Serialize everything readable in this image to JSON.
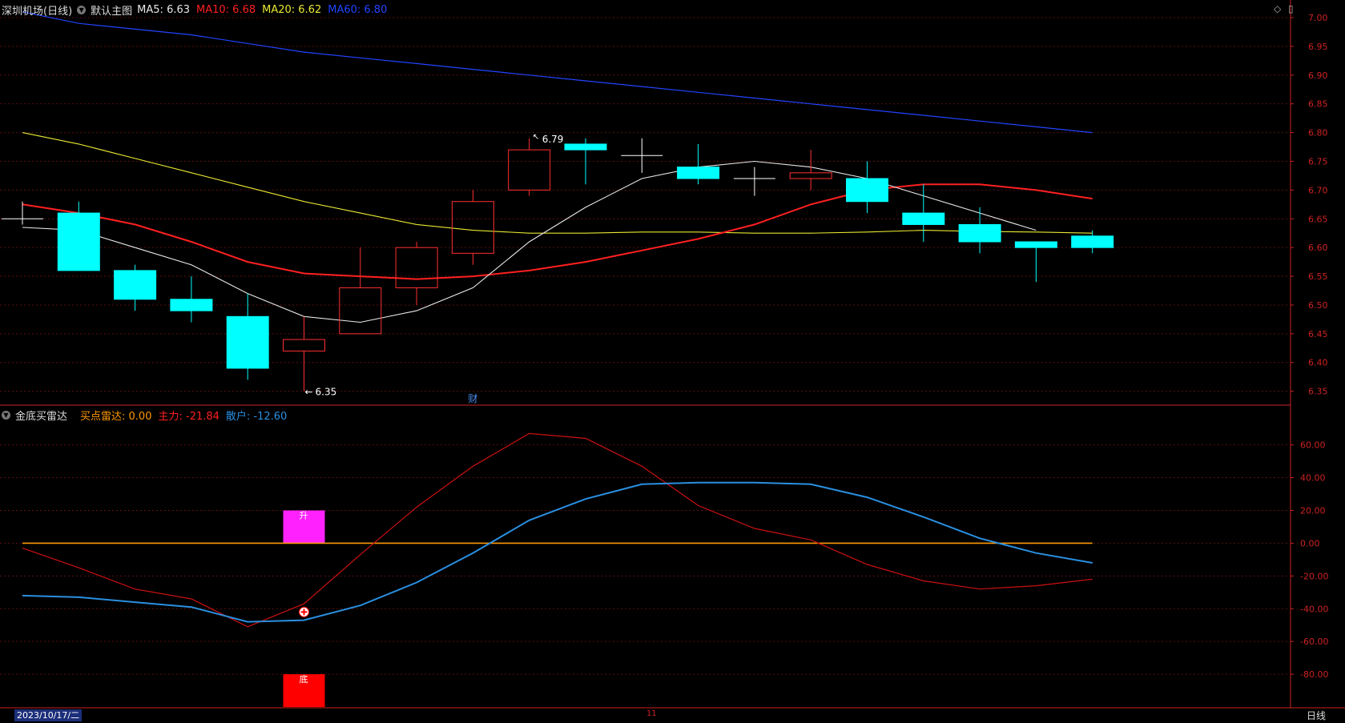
{
  "header": {
    "stock_name": "深圳机场(日线)",
    "template_name": "默认主图",
    "ma_items": [
      {
        "label": "MA5: 6.63",
        "color": "#e8e8e8"
      },
      {
        "label": "MA10: 6.68",
        "color": "#ff2020"
      },
      {
        "label": "MA20: 6.62",
        "color": "#e8e832"
      },
      {
        "label": "MA60: 6.80",
        "color": "#2244ff"
      }
    ]
  },
  "sub_header": {
    "indicator_name": "金底买雷达",
    "items": [
      {
        "label": "买点雷达: 0.00",
        "color": "#ff9900"
      },
      {
        "label": "主力: -21.84",
        "color": "#ff2020"
      },
      {
        "label": "散户: -12.60",
        "color": "#2a8fe0"
      }
    ]
  },
  "top_icons": {
    "diamond": "◇",
    "square": "▯"
  },
  "bottom_bar": {
    "date": "2023/10/17/二",
    "month_mark": "11",
    "period": "日线"
  },
  "colors": {
    "up": "#ff3030",
    "down": "#00ffff",
    "ma5": "#e8e8e8",
    "ma10": "#ff2020",
    "ma20": "#e8e832",
    "ma60": "#2244ff",
    "zero_line": "#ff9900",
    "main_force": "#cc1111",
    "retail": "#2a8fe0",
    "grid": "#5a1010",
    "axis": "#cc2222"
  },
  "chart_data": [
    {
      "type": "candlestick",
      "ylim": [
        6.33,
        7.0
      ],
      "y_ticks": [
        "7.00",
        "6.95",
        "6.90",
        "6.85",
        "6.80",
        "6.75",
        "6.70",
        "6.65",
        "6.60",
        "6.55",
        "6.50",
        "6.45",
        "6.40",
        "6.35"
      ],
      "candles": [
        {
          "o": 6.65,
          "h": 6.68,
          "l": 6.64,
          "c": 6.65
        },
        {
          "o": 6.66,
          "h": 6.68,
          "l": 6.56,
          "c": 6.56
        },
        {
          "o": 6.56,
          "h": 6.57,
          "l": 6.49,
          "c": 6.51
        },
        {
          "o": 6.51,
          "h": 6.55,
          "l": 6.47,
          "c": 6.49
        },
        {
          "o": 6.48,
          "h": 6.52,
          "l": 6.37,
          "c": 6.39
        },
        {
          "o": 6.42,
          "h": 6.48,
          "l": 6.35,
          "c": 6.44
        },
        {
          "o": 6.45,
          "h": 6.6,
          "l": 6.45,
          "c": 6.53
        },
        {
          "o": 6.53,
          "h": 6.61,
          "l": 6.5,
          "c": 6.6
        },
        {
          "o": 6.59,
          "h": 6.7,
          "l": 6.57,
          "c": 6.68
        },
        {
          "o": 6.7,
          "h": 6.79,
          "l": 6.69,
          "c": 6.77
        },
        {
          "o": 6.78,
          "h": 6.79,
          "l": 6.71,
          "c": 6.77
        },
        {
          "o": 6.76,
          "h": 6.79,
          "l": 6.73,
          "c": 6.76
        },
        {
          "o": 6.74,
          "h": 6.78,
          "l": 6.71,
          "c": 6.72
        },
        {
          "o": 6.72,
          "h": 6.74,
          "l": 6.69,
          "c": 6.72
        },
        {
          "o": 6.72,
          "h": 6.77,
          "l": 6.7,
          "c": 6.73
        },
        {
          "o": 6.72,
          "h": 6.75,
          "l": 6.66,
          "c": 6.68
        },
        {
          "o": 6.66,
          "h": 6.71,
          "l": 6.61,
          "c": 6.64
        },
        {
          "o": 6.64,
          "h": 6.67,
          "l": 6.59,
          "c": 6.61
        },
        {
          "o": 6.61,
          "h": 6.61,
          "l": 6.54,
          "c": 6.6
        },
        {
          "o": 6.62,
          "h": 6.63,
          "l": 6.59,
          "c": 6.6
        }
      ],
      "ma5": [
        6.635,
        6.63,
        6.6,
        6.57,
        6.52,
        6.48,
        6.47,
        6.49,
        6.53,
        6.61,
        6.67,
        6.72,
        6.74,
        6.75,
        6.74,
        6.72,
        6.69,
        6.66,
        6.63,
        null
      ],
      "ma10": [
        6.675,
        6.66,
        6.64,
        6.61,
        6.575,
        6.555,
        6.55,
        6.545,
        6.55,
        6.56,
        6.575,
        6.595,
        6.615,
        6.64,
        6.675,
        6.7,
        6.71,
        6.71,
        6.7,
        6.685
      ],
      "ma20": [
        6.8,
        6.78,
        6.755,
        6.73,
        6.705,
        6.68,
        6.66,
        6.64,
        6.63,
        6.625,
        6.625,
        6.627,
        6.627,
        6.625,
        6.625,
        6.627,
        6.63,
        6.628,
        6.627,
        6.625
      ],
      "ma60": [
        7.01,
        6.99,
        6.98,
        6.97,
        6.955,
        6.94,
        6.93,
        6.92,
        6.91,
        6.9,
        6.89,
        6.88,
        6.87,
        6.86,
        6.85,
        6.84,
        6.83,
        6.82,
        6.81,
        6.8
      ],
      "high_label": "6.79",
      "low_label": "6.35",
      "event_marker": "财"
    },
    {
      "type": "line",
      "ylim": [
        -100,
        75
      ],
      "y_ticks": [
        "60.00",
        "40.00",
        "20.00",
        "0.00",
        "-20.00",
        "-40.00",
        "-60.00",
        "-80.00"
      ],
      "series": [
        {
          "name": "主力",
          "values": [
            -3,
            -15,
            -28,
            -34,
            -51,
            -37,
            -7,
            22,
            47,
            67,
            64,
            47,
            23,
            9,
            2,
            -13,
            -23,
            -28,
            -26,
            -22
          ]
        },
        {
          "name": "散户",
          "values": [
            -32,
            -33,
            -36,
            -39,
            -48,
            -47,
            -38,
            -24,
            -6,
            14,
            27,
            36,
            37,
            37,
            36,
            28,
            16,
            3,
            -6,
            -12
          ]
        }
      ],
      "buy_radar": [
        0,
        0,
        0,
        0,
        0,
        0,
        0,
        0,
        0,
        0,
        0,
        0,
        0,
        0,
        0,
        0,
        0,
        0,
        0,
        0
      ],
      "signals": [
        {
          "index": 5,
          "label": "升",
          "from": 0,
          "to": 20,
          "color": "#ff22ff"
        },
        {
          "index": 5,
          "label": "底",
          "from": -80,
          "to": -100,
          "color": "#ff0000"
        }
      ],
      "buy_marker_index": 5
    }
  ]
}
